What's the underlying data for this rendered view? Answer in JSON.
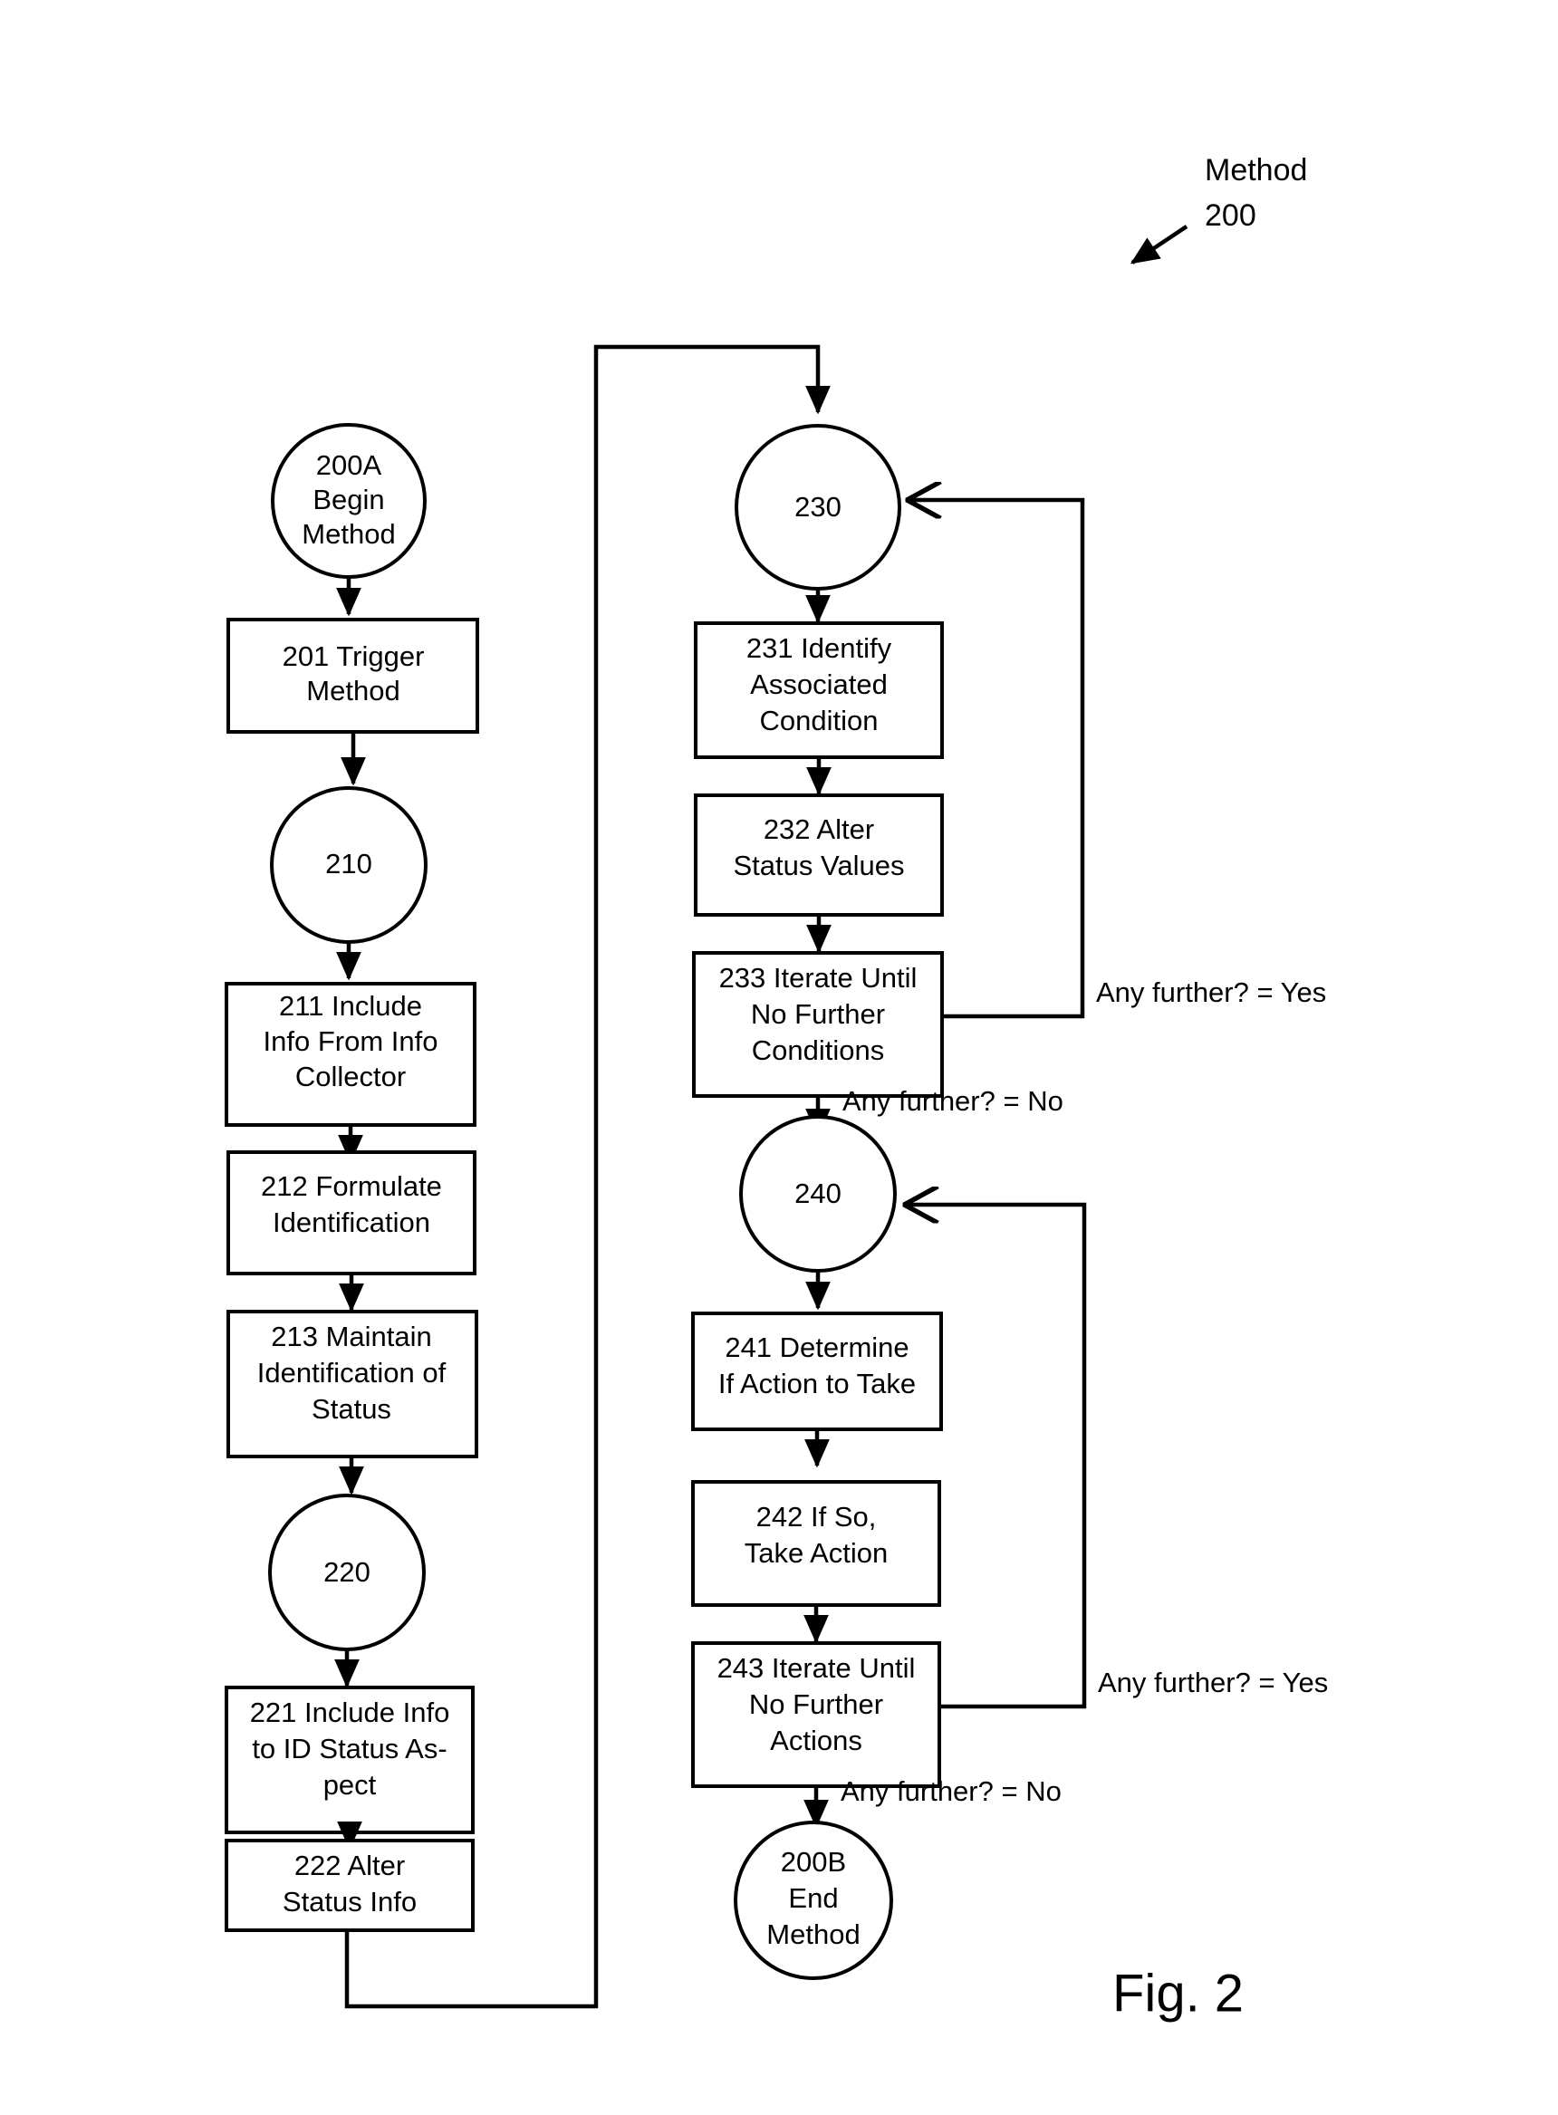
{
  "figure": {
    "caption": "Fig. 2",
    "title_label": "Method",
    "title_number": "200"
  },
  "nodes": {
    "start": {
      "id": "200A",
      "line1": "200A",
      "line2": "Begin",
      "line3": "Method",
      "shape": "circle"
    },
    "n201": {
      "line1": "201 Trigger",
      "line2": "Method",
      "shape": "rect"
    },
    "n210": {
      "line1": "210",
      "shape": "circle"
    },
    "n211": {
      "line1": "211 Include",
      "line2": "Info From Info",
      "line3": "Collector",
      "shape": "rect"
    },
    "n212": {
      "line1": "212 Formulate",
      "line2": "Identification",
      "shape": "rect"
    },
    "n213": {
      "line1": "213 Maintain",
      "line2": "Identification of",
      "line3": "Status",
      "shape": "rect"
    },
    "n220": {
      "line1": "220",
      "shape": "circle"
    },
    "n221": {
      "line1": "221 Include Info",
      "line2": "to ID Status As-",
      "line3": "pect",
      "shape": "rect"
    },
    "n222": {
      "line1": "222 Alter",
      "line2": "Status Info",
      "shape": "rect"
    },
    "n230": {
      "line1": "230",
      "shape": "circle"
    },
    "n231": {
      "line1": "231 Identify",
      "line2": "Associated",
      "line3": "Condition",
      "shape": "rect"
    },
    "n232": {
      "line1": "232 Alter",
      "line2": "Status Values",
      "shape": "rect"
    },
    "n233": {
      "line1": "233 Iterate Until",
      "line2": "No Further",
      "line3": "Conditions",
      "shape": "rect"
    },
    "n240": {
      "line1": "240",
      "shape": "circle"
    },
    "n241": {
      "line1": "241 Determine",
      "line2": "If Action to Take",
      "shape": "rect"
    },
    "n242": {
      "line1": "242 If So,",
      "line2": "Take Action",
      "shape": "rect"
    },
    "n243": {
      "line1": "243 Iterate Until",
      "line2": "No Further",
      "line3": "Actions",
      "shape": "rect"
    },
    "end": {
      "line1": "200B",
      "line2": "End",
      "line3": "Method",
      "shape": "circle"
    }
  },
  "edge_labels": {
    "cond_yes": "Any further? = Yes",
    "cond_no": "Any further? = No",
    "act_yes": "Any further? = Yes",
    "act_no": "Any further? = No"
  },
  "colors": {
    "ink": "#000000",
    "paper": "#ffffff"
  }
}
